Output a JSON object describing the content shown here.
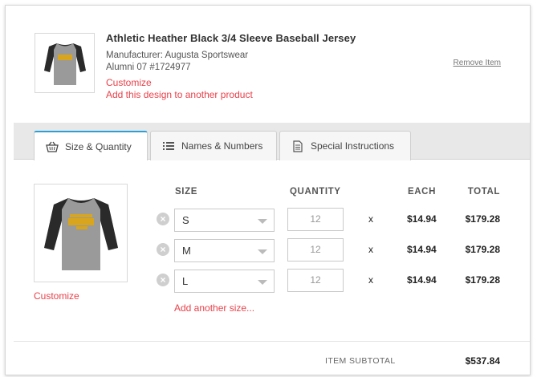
{
  "product": {
    "title": "Athletic Heather Black 3/4 Sleeve Baseball Jersey",
    "manufacturer": "Manufacturer: Augusta Sportswear",
    "design": "Alumni 07 #1724977",
    "customize": "Customize",
    "add_design": "Add this design to another product",
    "remove": "Remove Item"
  },
  "tabs": [
    {
      "label": "Size & Quantity",
      "icon": "basket-icon",
      "active": true
    },
    {
      "label": "Names & Numbers",
      "icon": "list-icon",
      "active": false
    },
    {
      "label": "Special Instructions",
      "icon": "document-icon",
      "active": false
    }
  ],
  "size_panel": {
    "customize": "Customize",
    "headers": {
      "size": "SIZE",
      "quantity": "QUANTITY",
      "each": "EACH",
      "total": "TOTAL"
    },
    "rows": [
      {
        "size": "S",
        "quantity": "12",
        "times": "x",
        "each": "$14.94",
        "total": "$179.28"
      },
      {
        "size": "M",
        "quantity": "12",
        "times": "x",
        "each": "$14.94",
        "total": "$179.28"
      },
      {
        "size": "L",
        "quantity": "12",
        "times": "x",
        "each": "$14.94",
        "total": "$179.28"
      }
    ],
    "add_size": "Add another size..."
  },
  "summary": {
    "subtotal_label": "ITEM SUBTOTAL",
    "subtotal_value": "$537.84"
  },
  "colors": {
    "accent_red": "#e8414a",
    "tab_active_border": "#2aa0d8",
    "shirt_body": "#9a9a9a",
    "shirt_sleeve": "#2a2a2a",
    "print_gold": "#d8a51c"
  }
}
